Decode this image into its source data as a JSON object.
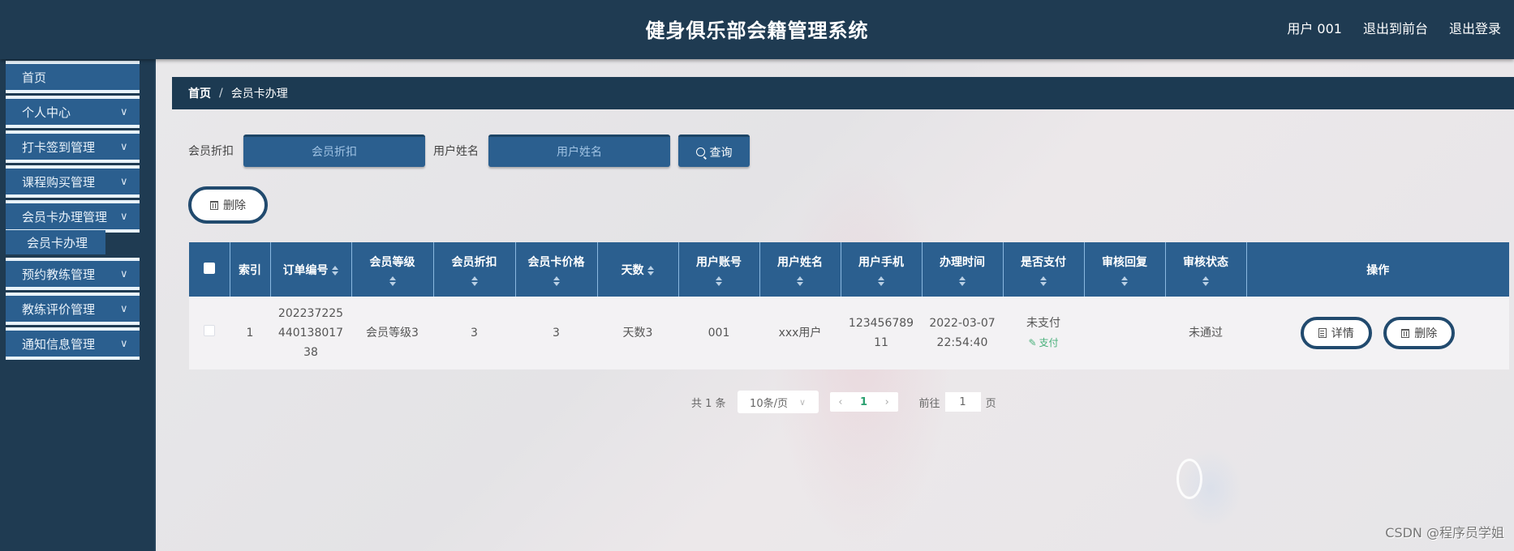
{
  "header": {
    "title": "健身俱乐部会籍管理系统",
    "user": "用户 001",
    "back_to_front": "退出到前台",
    "logout": "退出登录"
  },
  "sidebar": {
    "items": [
      {
        "label": "首页",
        "expandable": false
      },
      {
        "label": "个人中心",
        "expandable": true
      },
      {
        "label": "打卡签到管理",
        "expandable": true
      },
      {
        "label": "课程购买管理",
        "expandable": true
      },
      {
        "label": "会员卡办理管理",
        "expandable": true,
        "expanded": true,
        "children": [
          {
            "label": "会员卡办理",
            "active": true
          }
        ]
      },
      {
        "label": "预约教练管理",
        "expandable": true
      },
      {
        "label": "教练评价管理",
        "expandable": true
      },
      {
        "label": "通知信息管理",
        "expandable": true
      }
    ]
  },
  "breadcrumb": {
    "home": "首页",
    "separator": "/",
    "current": "会员卡办理"
  },
  "search": {
    "discount_label": "会员折扣",
    "discount_placeholder": "会员折扣",
    "discount_value": "",
    "username_label": "用户姓名",
    "username_placeholder": "用户姓名",
    "username_value": "",
    "query_button": "查询"
  },
  "toolbar": {
    "delete_button": "删除"
  },
  "table": {
    "columns": [
      {
        "label": "",
        "sortable": false
      },
      {
        "label": "索引",
        "sortable": false
      },
      {
        "label": "订单编号",
        "sortable": true
      },
      {
        "label": "会员等级",
        "sortable": true
      },
      {
        "label": "会员折扣",
        "sortable": true
      },
      {
        "label": "会员卡价格",
        "sortable": true
      },
      {
        "label": "天数",
        "sortable": true
      },
      {
        "label": "用户账号",
        "sortable": true
      },
      {
        "label": "用户姓名",
        "sortable": true
      },
      {
        "label": "用户手机",
        "sortable": true
      },
      {
        "label": "办理时间",
        "sortable": true
      },
      {
        "label": "是否支付",
        "sortable": true
      },
      {
        "label": "审核回复",
        "sortable": true
      },
      {
        "label": "审核状态",
        "sortable": true
      },
      {
        "label": "操作",
        "sortable": false
      }
    ],
    "rows": [
      {
        "index": "1",
        "order_no": "20223722544013801738",
        "level": "会员等级3",
        "discount": "3",
        "price": "3",
        "days": "天数3",
        "account": "001",
        "name": "xxx用户",
        "phone": "12345678911",
        "time": "2022-03-07 22:54:40",
        "paid_status": "未支付",
        "pay_action": "支付",
        "review_reply": "",
        "review_status": "未通过",
        "detail_button": "详情",
        "delete_button": "删除"
      }
    ]
  },
  "pagination": {
    "total": "共 1 条",
    "page_size": "10条/页",
    "current_page": "1",
    "goto_label": "前往",
    "goto_value": "1",
    "page_suffix": "页"
  },
  "watermark": "CSDN @程序员学姐"
}
